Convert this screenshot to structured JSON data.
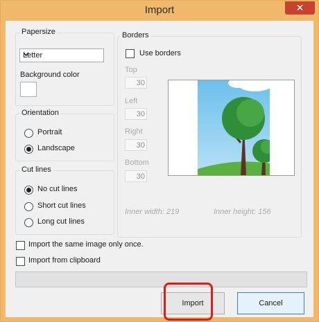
{
  "window": {
    "title": "Import",
    "close_glyph": "✕"
  },
  "papersize": {
    "label": "Papersize",
    "selected": "Letter"
  },
  "background_color": {
    "label": "Background color",
    "value": "#ffffff"
  },
  "orientation": {
    "label": "Orientation",
    "options": [
      "Portrait",
      "Landscape"
    ],
    "selected": "Landscape"
  },
  "cut_lines": {
    "label": "Cut lines",
    "options": [
      "No cut lines",
      "Short cut lines",
      "Long cut lines"
    ],
    "selected": "No cut lines"
  },
  "borders": {
    "label": "Borders",
    "use_borders_label": "Use borders",
    "use_borders_checked": false,
    "top_label": "Top",
    "top_value": "30",
    "left_label": "Left",
    "left_value": "30",
    "right_label": "Right",
    "right_value": "30",
    "bottom_label": "Bottom",
    "bottom_value": "30",
    "inner_width": "Inner width: 219",
    "inner_height": "Inner height: 156"
  },
  "options": {
    "import_once_label": "Import the same image only once.",
    "import_once_checked": false,
    "clipboard_label": "Import from clipboard",
    "clipboard_checked": false
  },
  "progress": {
    "value": 0
  },
  "buttons": {
    "import_label": "Import",
    "cancel_label": "Cancel"
  },
  "colors": {
    "accent_highlight": "#d6201f",
    "title_bar": "#f0b86b",
    "cancel_border": "#3c7fb1"
  }
}
